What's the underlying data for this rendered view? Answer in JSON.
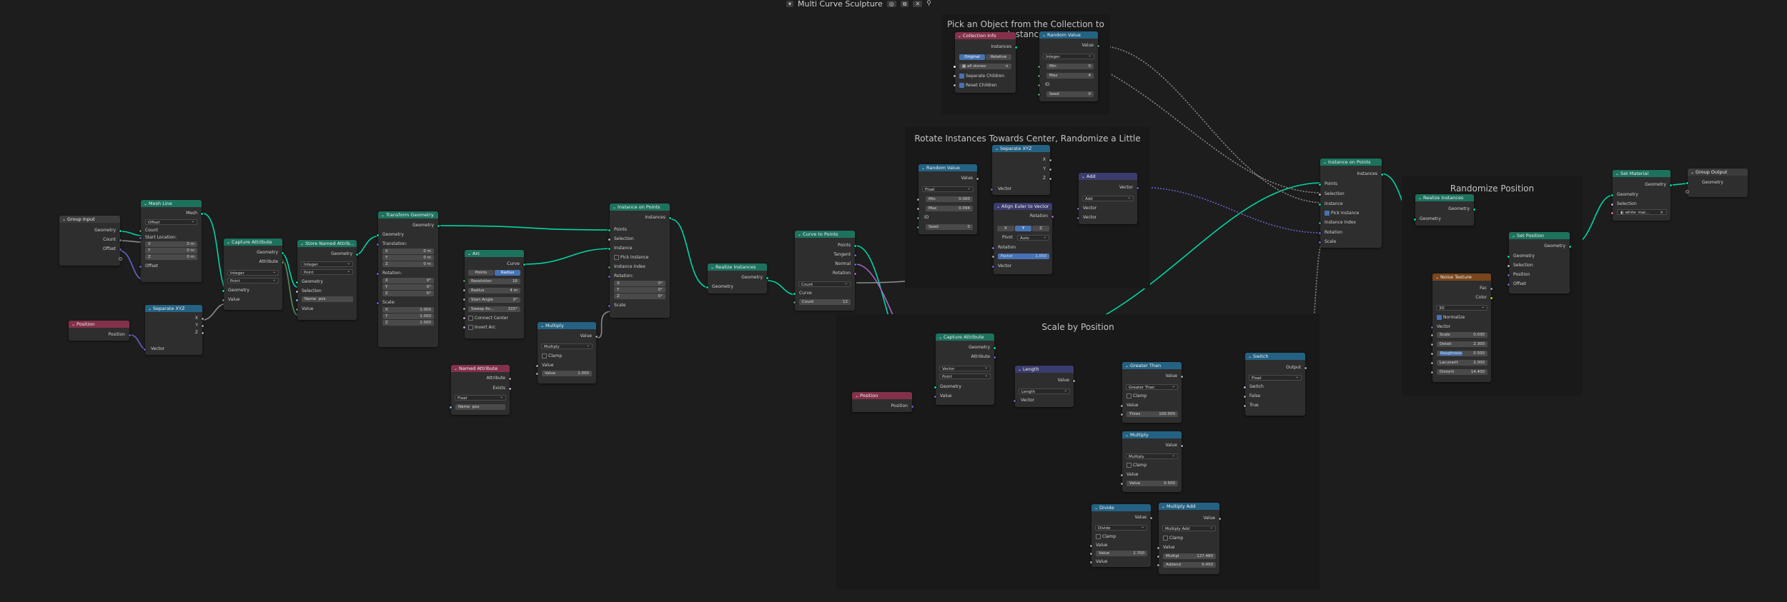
{
  "topbar": {
    "dropdown_label": "▾",
    "title": "Multi Curve Sculpture",
    "pin": "📌"
  },
  "frames": {
    "collection": "Pick an Object from the Collection to Instance",
    "rotate": "Rotate Instances Towards Center, Randomize a Little",
    "scale": "Scale by Position",
    "randomize": "Randomize Position"
  },
  "nodes": {
    "group_input": {
      "title": "Group Input",
      "outputs": [
        "Geometry",
        "Count",
        "Offset"
      ]
    },
    "mesh_line": {
      "title": "Mesh Line",
      "out": "Mesh",
      "mode": "Offset",
      "count": "Count",
      "start_location": "Start Location:",
      "x": "X",
      "xv": "0 m",
      "y": "Y",
      "yv": "0 m",
      "z": "Z",
      "zv": "0 m",
      "offset": "Offset"
    },
    "position_a": {
      "title": "Position",
      "out": "Position"
    },
    "separate_xyz_a": {
      "title": "Separate XYZ",
      "x": "X",
      "y": "Y",
      "z": "Z",
      "in": "Vector"
    },
    "capture_attr_a": {
      "title": "Capture Attribute",
      "geometry": "Geometry",
      "attribute": "Attribute",
      "type": "Integer",
      "domain": "Point",
      "in_geometry": "Geometry",
      "value": "Value"
    },
    "store_named": {
      "title": "Store Named Attrib...",
      "geometry": "Geometry",
      "type": "Integer",
      "domain": "Point",
      "in_geometry": "Geometry",
      "selection": "Selection",
      "name": "Name",
      "name_value": "pos",
      "value": "Value"
    },
    "transform": {
      "title": "Transform Geometry",
      "geometry": "Geometry",
      "in_geometry": "Geometry",
      "translation": "Translation:",
      "tx": "0 m",
      "ty": "0 m",
      "tz": "0 m",
      "rotation": "Rotation:",
      "rx": "0°",
      "ry": "0°",
      "rz": "0°",
      "scale": "Scale:",
      "sx": "1.000",
      "sy": "1.000",
      "sz": "1.000",
      "X": "X",
      "Y": "Y",
      "Z": "Z"
    },
    "arc": {
      "title": "Arc",
      "curve": "Curve",
      "mode_points": "Points",
      "mode_radius": "Radius",
      "resolution": "Resolution",
      "resolution_v": "16",
      "radius": "Radius",
      "radius_v": "4 m",
      "start_angle": "Start Angle",
      "start_angle_v": "0°",
      "sweep_angle": "Sweep An...",
      "sweep_angle_v": "315°",
      "connect_center": "Connect Center",
      "invert_arc": "Invert Arc"
    },
    "named_attr": {
      "title": "Named Attribute",
      "attribute": "Attribute",
      "exists": "Exists",
      "type": "Float",
      "name": "Name",
      "name_value": "pos"
    },
    "multiply_a": {
      "title": "Multiply",
      "value": "Value",
      "op": "Multiply",
      "clamp": "Clamp",
      "in_value": "Value",
      "in_value_b": "Value",
      "in_value_b_v": "1.000"
    },
    "inst_points_a": {
      "title": "Instance on Points",
      "instances": "Instances",
      "points": "Points",
      "selection": "Selection",
      "instance": "Instance",
      "pick": "Pick Instance",
      "index": "Instance Index",
      "rotation": "Rotation:",
      "rx": "0°",
      "ry": "0°",
      "rz": "0°",
      "scale": "Scale",
      "X": "X",
      "Y": "Y",
      "Z": "Z"
    },
    "realize_a": {
      "title": "Realize Instances",
      "out": "Geometry",
      "in": "Geometry"
    },
    "curve_to_points": {
      "title": "Curve to Points",
      "points": "Points",
      "tangent": "Tangent",
      "normal": "Normal",
      "rotation": "Rotation",
      "mode": "Count",
      "curve": "Curve",
      "count": "Count",
      "count_v": "12"
    },
    "collection_info": {
      "title": "Collection Info",
      "instances": "Instances",
      "original": "Original",
      "relative": "Relative",
      "collection": "all stones",
      "separate": "Separate Children",
      "reset": "Reset Children"
    },
    "random_a": {
      "title": "Random Value",
      "value": "Value",
      "type": "Integer",
      "min": "Min",
      "min_v": "0",
      "max": "Max",
      "max_v": "4",
      "id": "ID",
      "seed": "Seed",
      "seed_v": "0"
    },
    "random_b": {
      "title": "Random Value",
      "value": "Value",
      "type": "Float",
      "min": "Min",
      "min_v": "0.000",
      "max": "Max",
      "max_v": "0.094",
      "id": "ID",
      "seed": "Seed",
      "seed_v": "0"
    },
    "separate_xyz_b": {
      "title": "Separate XYZ",
      "x": "X",
      "y": "Y",
      "z": "Z",
      "in": "Vector"
    },
    "align_euler": {
      "title": "Align Euler to Vector",
      "rotation": "Rotation",
      "ax": "X",
      "ay": "Y",
      "az": "Z",
      "pivot": "Pivot",
      "pivot_v": "Auto",
      "in_rotation": "Rotation",
      "factor": "Factor",
      "factor_v": "1.000",
      "vector": "Vector"
    },
    "add_vec": {
      "title": "Add",
      "vector": "Vector",
      "op": "Add",
      "in_a": "Vector",
      "in_b": "Vector"
    },
    "inst_points_b": {
      "title": "Instance on Points",
      "instances": "Instances",
      "points": "Points",
      "selection": "Selection",
      "instance": "Instance",
      "pick": "Pick Instance",
      "index": "Instance Index",
      "rotation": "Rotation",
      "scale": "Scale"
    },
    "position_b": {
      "title": "Position",
      "out": "Position"
    },
    "capture_attr_b": {
      "title": "Capture Attribute",
      "geometry": "Geometry",
      "attribute": "Attribute",
      "type": "Vector",
      "domain": "Point",
      "in_geometry": "Geometry",
      "value": "Value"
    },
    "length": {
      "title": "Length",
      "value": "Value",
      "op": "Length",
      "vector": "Vector"
    },
    "greater": {
      "title": "Greater Than",
      "value": "Value",
      "op": "Greater Than",
      "clamp": "Clamp",
      "in_value": "Value",
      "thresh": "Thres",
      "thresh_v": "100.000"
    },
    "multiply_b": {
      "title": "Multiply",
      "value": "Value",
      "op": "Multiply",
      "clamp": "Clamp",
      "in_value": "Value",
      "in_value_b": "Value",
      "in_value_b_v": "0.500"
    },
    "divide": {
      "title": "Divide",
      "value": "Value",
      "op": "Divide",
      "clamp": "Clamp",
      "in_value": "Value",
      "in_value_b": "Value",
      "in_value_b_v": "2.700",
      "in_value_c": "Value"
    },
    "multiply_add": {
      "title": "Multiply Add",
      "value": "Value",
      "op": "Multiply Add",
      "clamp": "Clamp",
      "in_value": "Value",
      "multiplier": "Multipl",
      "multiplier_v": "127.480",
      "addend": "Addend",
      "addend_v": "0.450"
    },
    "switch": {
      "title": "Switch",
      "output": "Output",
      "type": "Float",
      "switch": "Switch",
      "false": "False",
      "true": "True"
    },
    "realize_b": {
      "title": "Realize Instances",
      "out": "Geometry",
      "in": "Geometry"
    },
    "noise": {
      "title": "Noise Texture",
      "fac": "Fac",
      "color": "Color",
      "dim": "3D",
      "normalize": "Normalize",
      "vector": "Vector",
      "scale": "Scale",
      "scale_v": "0.030",
      "detail": "Detail",
      "detail_v": "2.300",
      "rough": "Roughness",
      "rough_v": "0.500",
      "lac": "Lacunarit",
      "lac_v": "2.000",
      "distort": "Distorti",
      "distort_v": "14.400"
    },
    "set_position": {
      "title": "Set Position",
      "geometry": "Geometry",
      "in_geometry": "Geometry",
      "selection": "Selection",
      "position": "Position",
      "offset": "Offset"
    },
    "set_material": {
      "title": "Set Material",
      "geometry": "Geometry",
      "in_geometry": "Geometry",
      "selection": "Selection",
      "material": "white_mar..."
    },
    "group_output": {
      "title": "Group Output",
      "geometry": "Geometry"
    }
  }
}
